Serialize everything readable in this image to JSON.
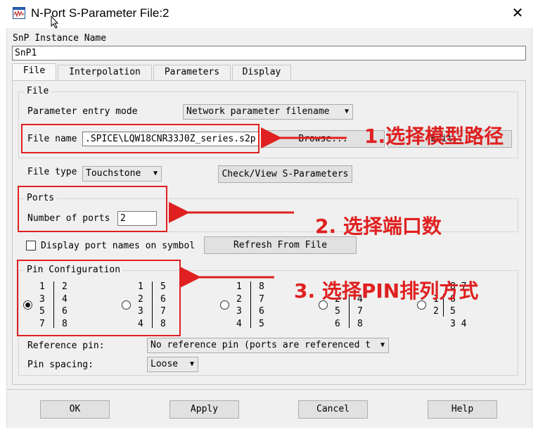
{
  "window": {
    "title": "N-Port S-Parameter File:2",
    "close_glyph": "✕"
  },
  "instance": {
    "label": "SnP Instance Name",
    "value": "SnP1"
  },
  "tabs": [
    {
      "label": "File",
      "active": true
    },
    {
      "label": "Interpolation",
      "active": false
    },
    {
      "label": "Parameters",
      "active": false
    },
    {
      "label": "Display",
      "active": false
    }
  ],
  "file_group": {
    "title": "File",
    "entry_mode_label": "Parameter entry mode",
    "entry_mode_value": "Network parameter filename",
    "file_name_label": "File name",
    "file_name_value": ".SPICE\\LQW18CNR33J0Z_series.s2p",
    "browse_label": "Browse...",
    "edit_label": "Edit...",
    "file_type_label": "File type",
    "file_type_value": "Touchstone",
    "check_view_label": "Check/View S-Parameters"
  },
  "ports_group": {
    "title": "Ports",
    "number_label": "Number of ports",
    "number_value": "2"
  },
  "display_names": {
    "label": "Display port names on symbol",
    "checked": false,
    "refresh_label": "Refresh From File"
  },
  "pin_group": {
    "title": "Pin Configuration",
    "options": [
      {
        "selected": true,
        "col1": "1\n3\n5\n7",
        "col2": "2\n4\n6\n8"
      },
      {
        "selected": false,
        "col1": "1\n2\n3\n4",
        "col2": "5\n6\n7\n8"
      },
      {
        "selected": false,
        "col1": "1\n2\n3\n4",
        "col2": "8\n7\n6\n5"
      },
      {
        "selected": false,
        "col1": "\n2\n5\n6",
        "col2": "\n4\n7\n8"
      },
      {
        "selected": false,
        "col1": "\n1\n2",
        "col2": "8 7\n6\n5\n3 4"
      }
    ],
    "reference_pin_label": "Reference pin:",
    "reference_pin_value": "No reference pin (ports are referenced t",
    "pin_spacing_label": "Pin spacing:",
    "pin_spacing_value": "Loose"
  },
  "buttons": {
    "ok": "OK",
    "apply": "Apply",
    "cancel": "Cancel",
    "help": "Help"
  },
  "annotations": {
    "step1": "1.选择模型路径",
    "step2": "2. 选择端口数",
    "step3": "3. 选择PIN排列方式",
    "color": "#e02020"
  },
  "icons": {
    "app": "waveform-file-icon",
    "close": "close-icon",
    "dropdown": "chevron-down-icon",
    "cursor": "mouse-pointer-icon"
  }
}
